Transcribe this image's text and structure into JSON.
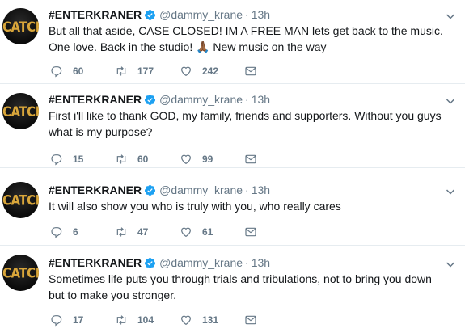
{
  "tweets": [
    {
      "name": "#ENTERKRANER",
      "handle": "@dammy_krane",
      "time": "13h",
      "text": "But all that aside, CASE CLOSED! IM A FREE MAN lets get back to the music. One love. Back in the studio! 🙏🏾 New music on the way",
      "replies": "60",
      "retweets": "177",
      "likes": "242"
    },
    {
      "name": "#ENTERKRANER",
      "handle": "@dammy_krane",
      "time": "13h",
      "text": "First i'll like to thank GOD, my family, friends and supporters. Without you guys what is my purpose?",
      "replies": "15",
      "retweets": "60",
      "likes": "99"
    },
    {
      "name": "#ENTERKRANER",
      "handle": "@dammy_krane",
      "time": "13h",
      "text": "It will also show you who is truly with you, who really cares",
      "replies": "6",
      "retweets": "47",
      "likes": "61"
    },
    {
      "name": "#ENTERKRANER",
      "handle": "@dammy_krane",
      "time": "13h",
      "text": "Sometimes life puts you through trials and tribulations, not to bring you down but to make you stronger.",
      "replies": "17",
      "retweets": "104",
      "likes": "131"
    }
  ],
  "avatar": {
    "word": "CATCH"
  },
  "colors": {
    "verified": "#1da1f2",
    "muted": "#657786",
    "divider": "#e6ecf0"
  },
  "icons": [
    "verified-badge-icon",
    "reply-icon",
    "retweet-icon",
    "like-icon",
    "message-icon",
    "chevron-down-icon"
  ]
}
